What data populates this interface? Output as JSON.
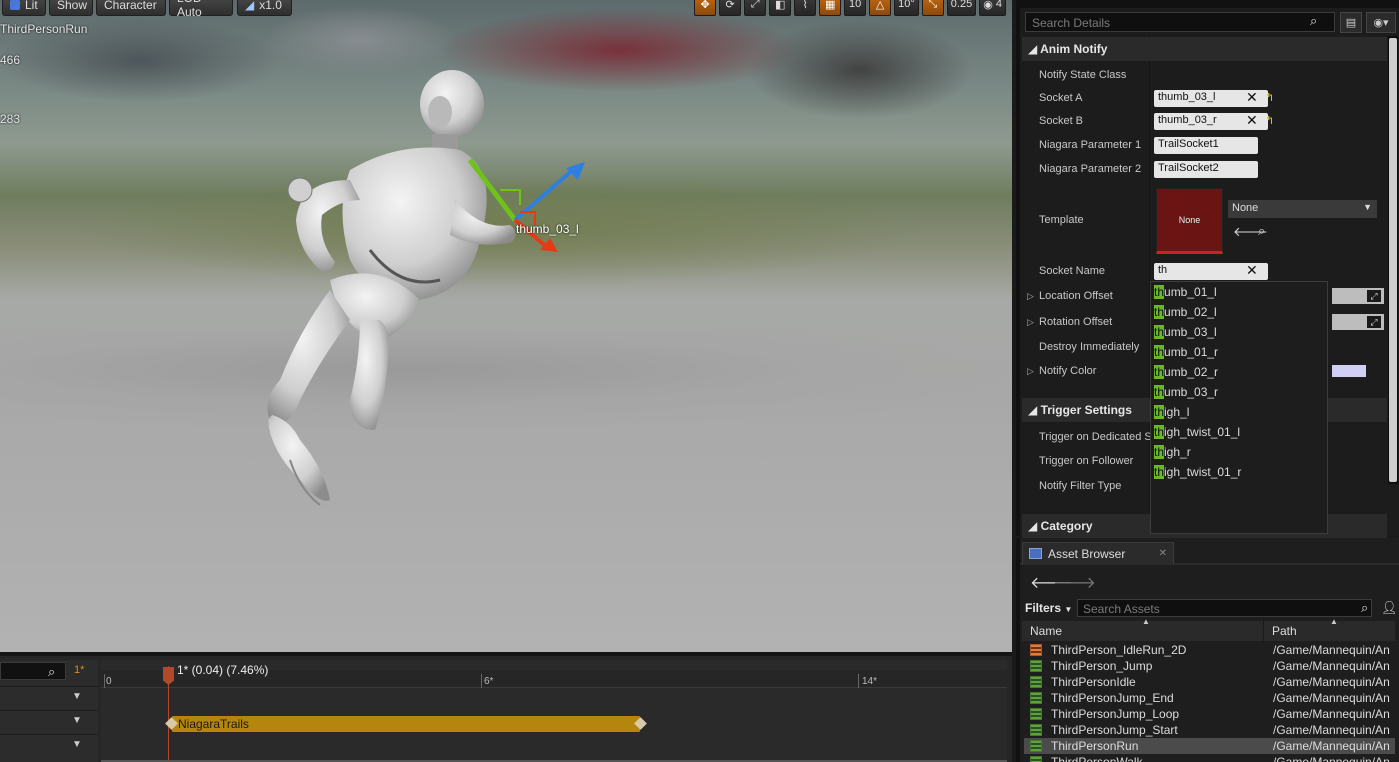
{
  "viewport": {
    "toolbar": {
      "lit": "Lit",
      "show": "Show",
      "character": "Character",
      "lod": "LOD Auto",
      "speed": "x1.0"
    },
    "right_toolbar": {
      "grid_snap": "10",
      "rot_snap": "10°",
      "scale_snap": "0.25",
      "cam_speed": "4"
    },
    "overlay": {
      "anim_name": "ThirdPersonRun",
      "stat1": "466",
      "stat2": "283"
    },
    "gizmo_label": "thumb_03_l"
  },
  "timeline": {
    "frame_indicator": "1*",
    "scrub_label": "1* (0.04) (7.46%)",
    "ticks": [
      "0",
      "6*",
      "14*"
    ],
    "notify_track": "NiagaraTrails"
  },
  "details": {
    "search_placeholder": "Search Details",
    "sections": {
      "anim_notify": "Anim Notify",
      "trigger_settings": "Trigger Settings",
      "category": "Category"
    },
    "props": {
      "notify_state_class": "Notify State Class",
      "socket_a": "Socket A",
      "socket_a_value": "thumb_03_l",
      "socket_b": "Socket B",
      "socket_b_value": "thumb_03_r",
      "niagara_param1": "Niagara Parameter 1",
      "niagara_param1_value": "TrailSocket1",
      "niagara_param2": "Niagara Parameter 2",
      "niagara_param2_value": "TrailSocket2",
      "template": "Template",
      "template_thumb": "None",
      "template_combo": "None",
      "socket_name": "Socket Name",
      "socket_name_value": "th",
      "location_offset": "Location Offset",
      "rotation_offset": "Rotation Offset",
      "destroy_immediately": "Destroy Immediately",
      "notify_color": "Notify Color",
      "trigger_dedicated": "Trigger on Dedicated S",
      "trigger_follower": "Trigger on Follower",
      "notify_filter_type": "Notify Filter Type"
    },
    "dropdown": {
      "match": "th",
      "items": [
        "thumb_01_l",
        "thumb_02_l",
        "thumb_03_l",
        "thumb_01_r",
        "thumb_02_r",
        "thumb_03_r",
        "thigh_l",
        "thigh_twist_01_l",
        "thigh_r",
        "thigh_twist_01_r"
      ]
    }
  },
  "asset_browser": {
    "tab": "Asset Browser",
    "filters": "Filters",
    "search_placeholder": "Search Assets",
    "col_name": "Name",
    "col_path": "Path",
    "rows": [
      {
        "name": "ThirdPerson_IdleRun_2D",
        "path": "/Game/Mannequin/An"
      },
      {
        "name": "ThirdPerson_Jump",
        "path": "/Game/Mannequin/An"
      },
      {
        "name": "ThirdPersonIdle",
        "path": "/Game/Mannequin/An"
      },
      {
        "name": "ThirdPersonJump_End",
        "path": "/Game/Mannequin/An"
      },
      {
        "name": "ThirdPersonJump_Loop",
        "path": "/Game/Mannequin/An"
      },
      {
        "name": "ThirdPersonJump_Start",
        "path": "/Game/Mannequin/An"
      },
      {
        "name": "ThirdPersonRun",
        "path": "/Game/Mannequin/An"
      },
      {
        "name": "ThirdPersonWalk",
        "path": "/Game/Mannequin/An"
      }
    ]
  },
  "colors": {
    "highlight": "#6ab72a",
    "notify_bar": "#b5860e",
    "template_red": "#6b1414",
    "playhead": "#b04a2a"
  }
}
